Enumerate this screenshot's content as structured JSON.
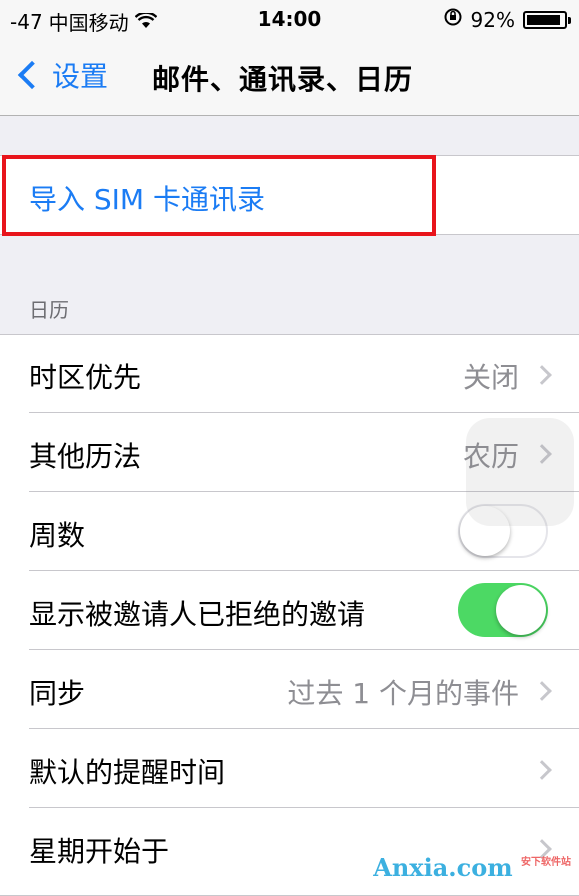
{
  "status_bar": {
    "signal": "-47",
    "carrier": "中国移动",
    "time": "14:00",
    "battery": "92%",
    "battery_level": 0.92
  },
  "nav": {
    "back_label": "设置",
    "title": "邮件、通讯录、日历"
  },
  "import_sim": {
    "label": "导入 SIM 卡通讯录"
  },
  "calendar_section": {
    "header": "日历",
    "rows": [
      {
        "label": "时区优先",
        "value": "关闭"
      },
      {
        "label": "其他历法",
        "value": "农历"
      },
      {
        "label": "周数",
        "toggle": false
      },
      {
        "label": "显示被邀请人已拒绝的邀请",
        "toggle": true
      },
      {
        "label": "同步",
        "value": "过去 1 个月的事件"
      },
      {
        "label": "默认的提醒时间",
        "value": ""
      },
      {
        "label": "星期开始于",
        "value": ""
      }
    ]
  },
  "watermark": {
    "text": "Anxia",
    "suffix": ".com",
    "tag": "安下软件站"
  },
  "colors": {
    "accent": "#1b7cf4",
    "toggle_on": "#4cd964",
    "highlight": "#e8141b"
  }
}
